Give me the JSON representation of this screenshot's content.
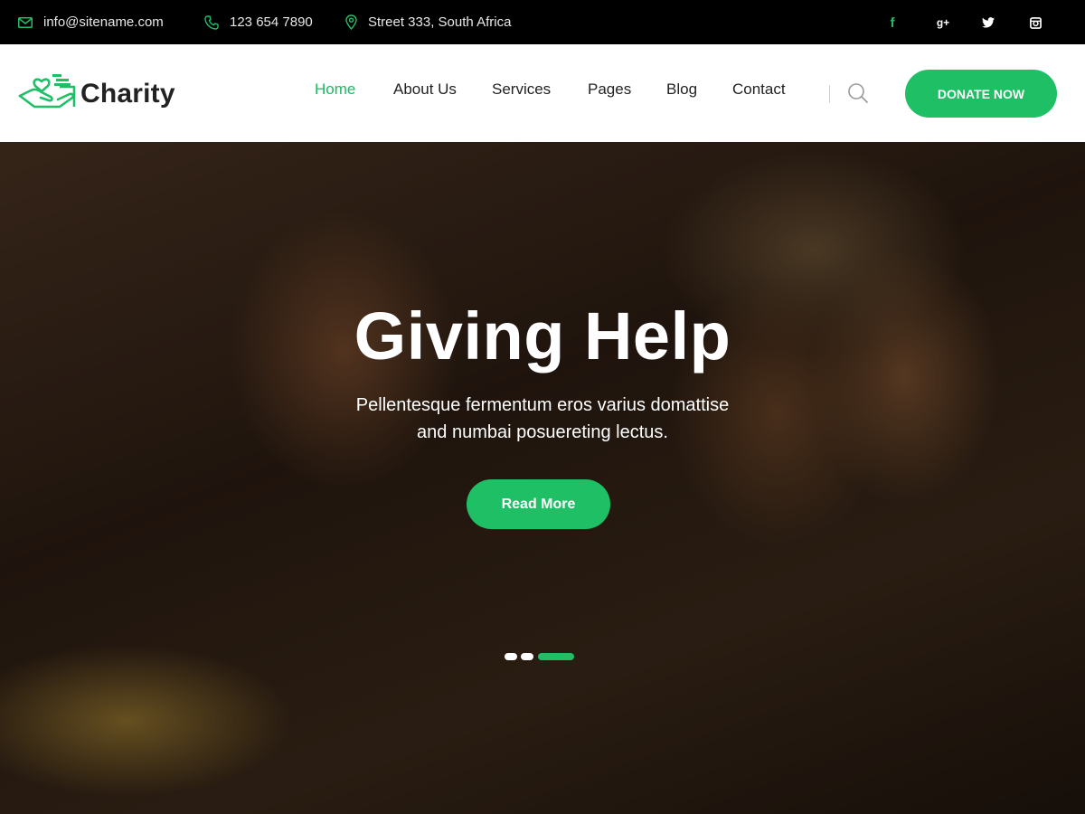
{
  "topbar": {
    "email": "info@sitename.com",
    "phone": "123 654 7890",
    "address": "Street 333, South Africa",
    "social": [
      {
        "icon": "facebook-icon",
        "glyph": "f"
      },
      {
        "icon": "google-plus-icon",
        "glyph": "g+"
      },
      {
        "icon": "twitter-icon"
      },
      {
        "icon": "instagram-icon"
      }
    ]
  },
  "header": {
    "logo_text": "Charity",
    "nav": [
      "Home",
      "About Us",
      "Services",
      "Pages",
      "Blog",
      "Contact"
    ],
    "active_nav": "Home",
    "donate_label": "DONATE NOW"
  },
  "hero": {
    "title": "Giving Help",
    "subtitle_line1": "Pellentesque fermentum eros varius domattise",
    "subtitle_line2": "and numbai posuereting lectus.",
    "button_label": "Read More",
    "slides": 3,
    "active_slide": 3
  },
  "colors": {
    "accent": "#1fbf66",
    "topbar_bg": "#000000",
    "header_bg": "#ffffff",
    "nav_text": "#222222"
  }
}
